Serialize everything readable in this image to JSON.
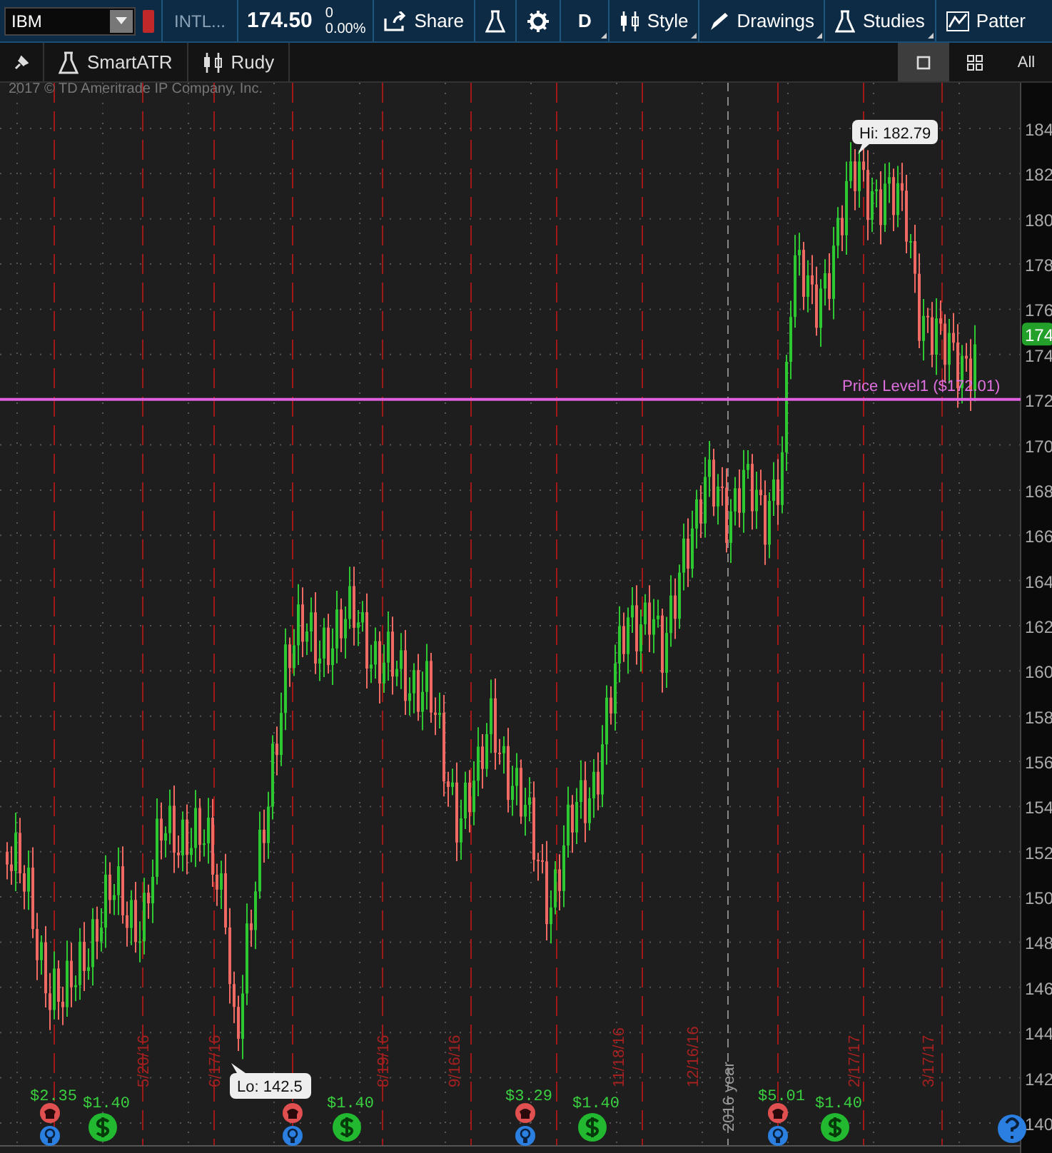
{
  "symbol": {
    "value": "IBM"
  },
  "exchange": "INTL...",
  "price": "174.50",
  "change": "0",
  "change_percent": "0.00%",
  "toolbar": {
    "share": "Share",
    "period": "D",
    "style": "Style",
    "drawings": "Drawings",
    "studies": "Studies",
    "patterns": "Patter"
  },
  "studies": [
    {
      "kind": "flask",
      "label": "SmartATR"
    },
    {
      "kind": "candle",
      "label": "Rudy"
    }
  ],
  "layouts": [
    {
      "kind": "single",
      "selected": true
    },
    {
      "kind": "grid",
      "selected": false
    },
    {
      "kind": "text",
      "label": "All",
      "selected": false
    }
  ],
  "chart": {
    "copyright": "2017 © TD Ameritrade IP Company, Inc.",
    "y_ticks": [
      "184",
      "182",
      "180",
      "178",
      "176",
      "174",
      "172",
      "170",
      "168",
      "166",
      "164",
      "162",
      "160",
      "158",
      "156",
      "154",
      "152",
      "150",
      "148",
      "146",
      "144",
      "142",
      "140"
    ],
    "last_price": "174",
    "high_label": "Hi: 182.79",
    "low_label": "Lo: 142.5",
    "price_level": "Price Level1 ($172.01)",
    "date_labels": [
      "5/20/16",
      "6/17/16",
      "8/19/16",
      "9/16/16",
      "11/18/16",
      "12/16/16",
      "2016 year",
      "2/17/17",
      "3/17/17"
    ],
    "events": [
      {
        "kind": "earnings",
        "amount": "$2.35"
      },
      {
        "kind": "dividend",
        "amount": "$1.40"
      },
      {
        "kind": "earnings"
      },
      {
        "kind": "dividend",
        "amount": "$1.40"
      },
      {
        "kind": "earnings",
        "amount": "$3.29"
      },
      {
        "kind": "dividend",
        "amount": "$1.40"
      },
      {
        "kind": "earnings",
        "amount": "$5.01"
      },
      {
        "kind": "dividend",
        "amount": "$1.40"
      }
    ]
  }
}
